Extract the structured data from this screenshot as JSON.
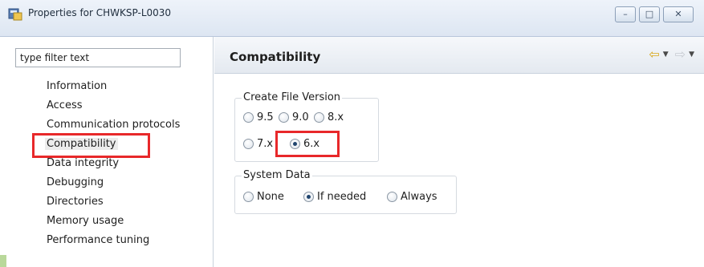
{
  "window": {
    "title": "Properties for CHWKSP-L0030",
    "controls": {
      "minimize": "–",
      "maximize": "□",
      "close": "✕"
    }
  },
  "filter": {
    "placeholder": "type filter text",
    "value": ""
  },
  "tree": {
    "items": [
      {
        "label": "Information"
      },
      {
        "label": "Access"
      },
      {
        "label": "Communication protocols"
      },
      {
        "label": "Compatibility",
        "selected": true
      },
      {
        "label": "Data integrity"
      },
      {
        "label": "Debugging"
      },
      {
        "label": "Directories"
      },
      {
        "label": "Memory usage"
      },
      {
        "label": "Performance tuning"
      }
    ]
  },
  "page": {
    "title": "Compatibility",
    "nav": {
      "back": "⇦",
      "forward": "⇨",
      "dropdown": "▼"
    }
  },
  "create_file_version": {
    "legend": "Create File Version",
    "options": [
      {
        "label": "9.5",
        "selected": false
      },
      {
        "label": "9.0",
        "selected": false
      },
      {
        "label": "8.x",
        "selected": false
      },
      {
        "label": "7.x",
        "selected": false
      },
      {
        "label": "6.x",
        "selected": true
      }
    ]
  },
  "system_data": {
    "legend": "System Data",
    "options": [
      {
        "label": "None",
        "selected": false
      },
      {
        "label": "If needed",
        "selected": true
      },
      {
        "label": "Always",
        "selected": false
      }
    ]
  },
  "colors": {
    "highlight": "#e8282a",
    "title_bar": "#dde6f2",
    "selection_bg": "#ececec"
  }
}
